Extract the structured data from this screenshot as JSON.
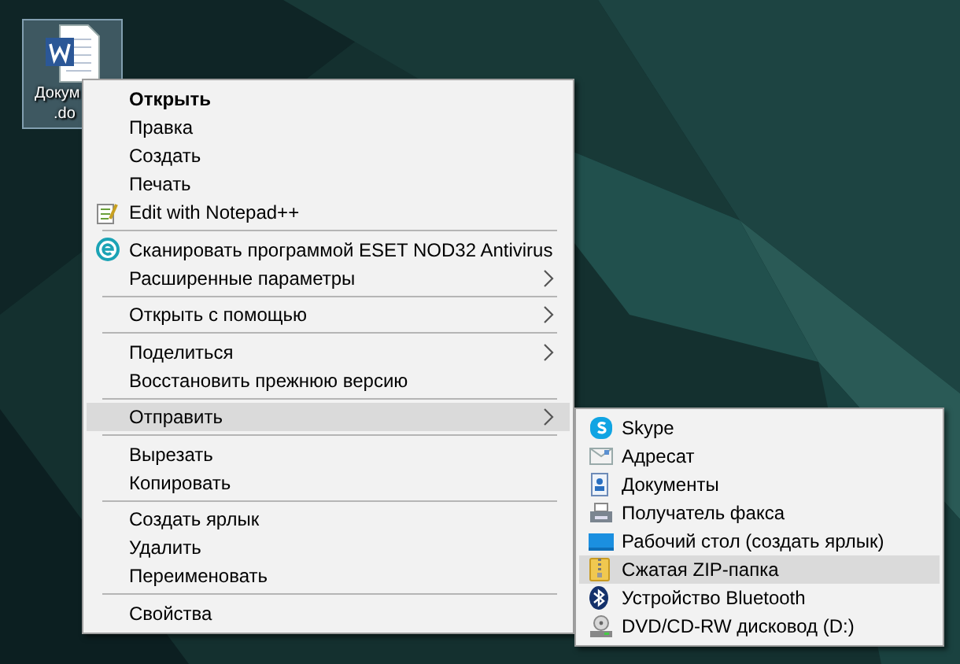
{
  "desktop_icons": [
    {
      "label_lines": [
        "Докум",
        ".do"
      ],
      "selected": true
    }
  ],
  "context_menu": {
    "items": [
      {
        "kind": "item",
        "label": "Открыть",
        "default": true,
        "submenu": false,
        "selected": false
      },
      {
        "kind": "item",
        "label": "Правка",
        "default": false,
        "submenu": false,
        "selected": false
      },
      {
        "kind": "item",
        "label": "Создать",
        "default": false,
        "submenu": false,
        "selected": false
      },
      {
        "kind": "item",
        "label": "Печать",
        "default": false,
        "submenu": false,
        "selected": false
      },
      {
        "kind": "item",
        "label": "Edit with Notepad++",
        "default": false,
        "submenu": false,
        "selected": false
      },
      {
        "kind": "separator"
      },
      {
        "kind": "item",
        "label": "Сканировать программой ESET NOD32 Antivirus",
        "default": false,
        "submenu": false,
        "selected": false
      },
      {
        "kind": "item",
        "label": "Расширенные параметры",
        "default": false,
        "submenu": true,
        "selected": false
      },
      {
        "kind": "separator"
      },
      {
        "kind": "item",
        "label": "Открыть с помощью",
        "default": false,
        "submenu": true,
        "selected": false
      },
      {
        "kind": "separator"
      },
      {
        "kind": "item",
        "label": "Поделиться",
        "default": false,
        "submenu": true,
        "selected": false
      },
      {
        "kind": "item",
        "label": "Восстановить прежнюю версию",
        "default": false,
        "submenu": false,
        "selected": false
      },
      {
        "kind": "separator"
      },
      {
        "kind": "item",
        "label": "Отправить",
        "default": false,
        "submenu": true,
        "selected": true
      },
      {
        "kind": "separator"
      },
      {
        "kind": "item",
        "label": "Вырезать",
        "default": false,
        "submenu": false,
        "selected": false
      },
      {
        "kind": "item",
        "label": "Копировать",
        "default": false,
        "submenu": false,
        "selected": false
      },
      {
        "kind": "separator"
      },
      {
        "kind": "item",
        "label": "Создать ярлык",
        "default": false,
        "submenu": false,
        "selected": false
      },
      {
        "kind": "item",
        "label": "Удалить",
        "default": false,
        "submenu": false,
        "selected": false
      },
      {
        "kind": "item",
        "label": "Переименовать",
        "default": false,
        "submenu": false,
        "selected": false
      },
      {
        "kind": "separator"
      },
      {
        "kind": "item",
        "label": "Свойства",
        "default": false,
        "submenu": false,
        "selected": false
      }
    ]
  },
  "send_to_menu": {
    "items": [
      {
        "label": "Skype",
        "selected": false
      },
      {
        "label": "Адресат",
        "selected": false
      },
      {
        "label": "Документы",
        "selected": false
      },
      {
        "label": "Получатель факса",
        "selected": false
      },
      {
        "label": "Рабочий стол (создать ярлык)",
        "selected": false
      },
      {
        "label": "Сжатая ZIP-папка",
        "selected": true
      },
      {
        "label": "Устройство Bluetooth",
        "selected": false
      },
      {
        "label": "DVD/CD-RW дисковод (D:)",
        "selected": false
      }
    ]
  }
}
